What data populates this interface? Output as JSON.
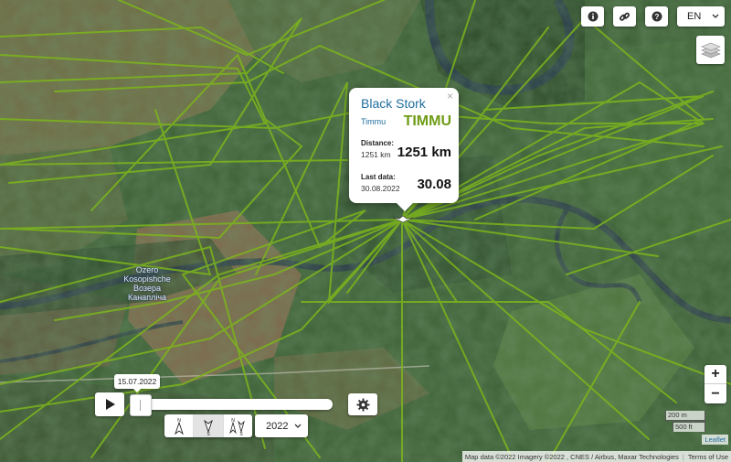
{
  "toolbar": {
    "info_icon": "info-icon",
    "link_icon": "link-icon",
    "help_icon": "help-icon",
    "language": "EN"
  },
  "popup": {
    "title": "Black Stork",
    "close": "×",
    "bird_name": "Timmu",
    "tag_code": "TIMMU",
    "distance_label": "Distance:",
    "distance_small": "1251 km",
    "distance_big": "1251 km",
    "last_data_label": "Last data:",
    "last_data_date": "30.08.2022",
    "last_data_big": "30.08"
  },
  "place_label": {
    "line1": "Ozero",
    "line2": "Kosopishche",
    "line3": "Возера",
    "line4": "Канапліча"
  },
  "timeline": {
    "date": "15.07.2022",
    "progress": 0.0,
    "year": "2022",
    "year_options": [
      "2022"
    ]
  },
  "zoom": {
    "in": "+",
    "out": "−"
  },
  "scale": {
    "metric": "200 m",
    "imperial": "500 ft"
  },
  "attribution": {
    "leaflet": "Leaflet",
    "text": "Map data ©2022 Imagery ©2022 , CNES / Airbus, Maxar Technologies",
    "terms": "Terms of Use"
  },
  "colors": {
    "track": "#7cb51c",
    "popup_title": "#1f6e9e",
    "tag_code": "#6f9c16"
  }
}
